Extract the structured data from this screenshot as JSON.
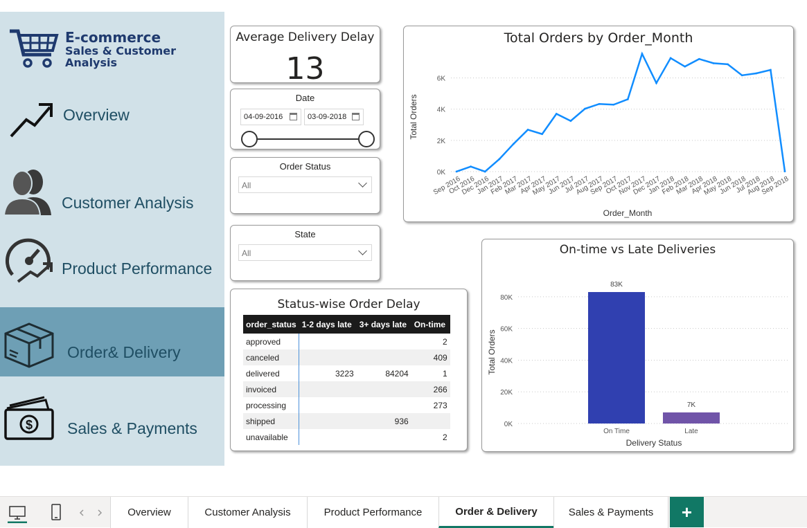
{
  "logo": {
    "line1": "E-commerce",
    "line2": "Sales & Customer",
    "line3": "Analysis",
    "icon": "shopping-cart-icon"
  },
  "nav": [
    {
      "label": "Overview",
      "icon": "trend-arrow-icon"
    },
    {
      "label": "Customer Analysis",
      "icon": "people-icon"
    },
    {
      "label": "Product Performance",
      "icon": "speedometer-icon"
    },
    {
      "label": "Order& Delivery",
      "icon": "package-box-icon",
      "active": true
    },
    {
      "label": "Sales & Payments",
      "icon": "cash-icon"
    }
  ],
  "kpi": {
    "title": "Average Delivery Delay",
    "value": "13"
  },
  "date_slicer": {
    "title": "Date",
    "start": "04-09-2016",
    "end": "03-09-2018"
  },
  "order_status_slicer": {
    "title": "Order Status",
    "value": "All"
  },
  "state_slicer": {
    "title": "State",
    "value": "All"
  },
  "status_table": {
    "title": "Status-wise Order Delay",
    "columns": [
      "order_status",
      "1-2 days late",
      "3+ days late",
      "On-time"
    ],
    "rows": [
      [
        "approved",
        "",
        "",
        "2"
      ],
      [
        "canceled",
        "",
        "",
        "409"
      ],
      [
        "delivered",
        "3223",
        "84204",
        "1"
      ],
      [
        "invoiced",
        "",
        "",
        "266"
      ],
      [
        "processing",
        "",
        "",
        "273"
      ],
      [
        "shipped",
        "",
        "936",
        ""
      ],
      [
        "unavailable",
        "",
        "",
        "2"
      ]
    ]
  },
  "chart_data": [
    {
      "type": "line",
      "title": "Total Orders by Order_Month",
      "xlabel": "Order_Month",
      "ylabel": "Total Orders",
      "ylim": [
        0,
        7000
      ],
      "yticks": [
        0,
        2000,
        4000,
        6000
      ],
      "ytick_labels": [
        "0K",
        "2K",
        "4K",
        "6K"
      ],
      "grid": true,
      "color": "#118dff",
      "categories": [
        "Sep 2016",
        "Oct 2016",
        "Dec 2016",
        "Jan 2017",
        "Feb 2017",
        "Mar 2017",
        "Apr 2017",
        "May 2017",
        "Jun 2017",
        "Jul 2017",
        "Aug 2017",
        "Sep 2017",
        "Oct 2017",
        "Nov 2017",
        "Dec 2017",
        "Jan 2018",
        "Feb 2018",
        "Mar 2018",
        "Apr 2018",
        "May 2018",
        "Jun 2018",
        "Jul 2018",
        "Aug 2018",
        "Sep 2018"
      ],
      "values": [
        4,
        324,
        1,
        800,
        1780,
        2682,
        2404,
        3700,
        3245,
        4026,
        4331,
        4285,
        4631,
        7544,
        5673,
        7269,
        6728,
        7211,
        6939,
        6873,
        6167,
        6292,
        6512,
        16
      ]
    },
    {
      "type": "bar",
      "title": "On-time vs Late Deliveries",
      "xlabel": "Delivery Status",
      "ylabel": "Total Orders",
      "ylim": [
        0,
        90000
      ],
      "yticks": [
        0,
        20000,
        40000,
        60000,
        80000
      ],
      "ytick_labels": [
        "0K",
        "20K",
        "40K",
        "60K",
        "80K"
      ],
      "grid": true,
      "categories": [
        "On Time",
        "Late"
      ],
      "values": [
        83000,
        7000
      ],
      "data_labels": [
        "83K",
        "7K"
      ],
      "colors": [
        "#3040b0",
        "#7054a8"
      ]
    }
  ],
  "tabs": [
    {
      "label": "Overview"
    },
    {
      "label": "Customer Analysis"
    },
    {
      "label": "Product Performance"
    },
    {
      "label": "Order & Delivery",
      "active": true
    },
    {
      "label": "Sales & Payments"
    }
  ],
  "add_tab_label": "+"
}
